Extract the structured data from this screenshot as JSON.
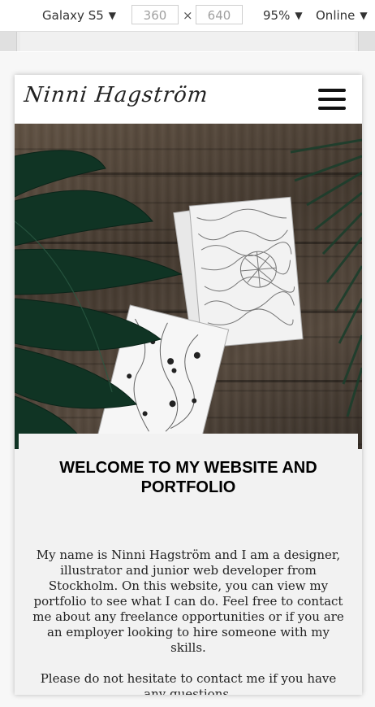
{
  "devtools": {
    "device": "Galaxy S5",
    "width": "360",
    "height": "640",
    "separator": "×",
    "zoom": "95%",
    "network": "Online"
  },
  "site": {
    "logo_text": "Ninni Hagström",
    "welcome_title": "WELCOME TO MY WEBSITE AND PORTFOLIO",
    "intro": "My name is Ninni Hagström and I am a designer, illustrator and junior web developer from Stockholm. On this website, you can view my portfolio to see what I can do. Feel free to contact me about any freelance opportunities or if you are an employer looking to hire someone with my skills.",
    "contact": "Please do not hesitate to contact me if you have any questions."
  },
  "icons": {
    "menu": "hamburger-menu-icon",
    "dropdown": "caret-down-icon"
  },
  "colors": {
    "header_bg": "#ffffff",
    "page_bg": "#f2f2f2",
    "leaf": "#133826",
    "wood": "#5a4a3c"
  }
}
